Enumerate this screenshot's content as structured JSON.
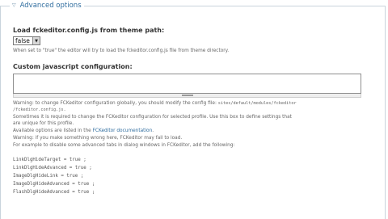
{
  "fieldset": {
    "legend_icon": "triangle-down-icon",
    "legend": "Advanced options"
  },
  "load_config": {
    "label": "Load fckeditor.config.js from theme path:",
    "selected": "false",
    "description": "When set to \"true\" the editor will try to load the fckeditor.config.js file from theme directory."
  },
  "custom_js": {
    "label": "Custom javascript configuration:",
    "value": ""
  },
  "help": {
    "warning1_prefix": "Warning: to change FCKeditor configuration globally, you should modify the config file: ",
    "warning1_path": "sites/default/modules/fckeditor",
    "warning1_path2": "/fckeditor.config.js.",
    "sometimes": "Sometimes it is required to change the FCKeditor configuration for selected profile. Use this box to define settings that",
    "unique": "are unique for this profile.",
    "available_prefix": "Available options are listed in the ",
    "doc_link": "FCKeditor documentation",
    "available_suffix": ".",
    "warning2": "Warning: if you make something wrong here, FCKeditor may fail to load.",
    "example": "For example to disable some advanced tabs in dialog windows in FCKeditor, add the following:"
  },
  "code_lines": [
    "LinkDlgHideTarget = true ;",
    "LinkDlgHideAdvanced = true ;",
    "ImageDlgHideLink = true ;",
    "ImageDlgHideAdvanced = true ;",
    "FlashDlgHideAdvanced = true ;"
  ]
}
